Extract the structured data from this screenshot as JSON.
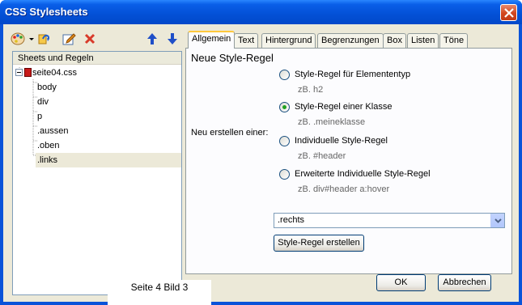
{
  "window": {
    "title": "CSS Stylesheets"
  },
  "toolbar": {
    "icons": [
      "palette-icon",
      "dropdown-arrow-icon",
      "import-icon",
      "edit-icon",
      "delete-icon",
      "move-up-icon",
      "move-down-icon"
    ]
  },
  "tree": {
    "header": "Sheets und Regeln",
    "root": "seite04.css",
    "items": [
      "body",
      "div",
      "p",
      ".aussen",
      ".oben",
      ".links"
    ],
    "selected": ".links"
  },
  "tabs": [
    "Allgemein",
    "Text",
    "Hintergrund",
    "Begrenzungen",
    "Box",
    "Listen",
    "Töne"
  ],
  "active_tab": "Allgemein",
  "panel": {
    "title": "Neue Style-Regel",
    "create_label": "Neu erstellen einer:",
    "options": [
      {
        "label": "Style-Regel für Elemententyp",
        "hint": "zB. h2",
        "checked": false
      },
      {
        "label": "Style-Regel einer Klasse",
        "hint": "zB. .meineklasse",
        "checked": true
      },
      {
        "label": "Individuelle Style-Regel",
        "hint": "zB. #header",
        "checked": false
      },
      {
        "label": "Erweiterte Individuelle Style-Regel",
        "hint": "zB. div#header a:hover",
        "checked": false
      }
    ],
    "select_value": ".rechts",
    "create_button": "Style-Regel erstellen"
  },
  "footer": {
    "ok_label": "OK",
    "cancel_label": "Abbrechen",
    "caption": "Seite 4 Bild 3"
  },
  "colors": {
    "titlebar": "#0350d6",
    "dialog_bg": "#ece9d8",
    "tab_highlight": "#ffc83c",
    "radio_dot": "#21a121",
    "close_button": "#d2461f"
  }
}
